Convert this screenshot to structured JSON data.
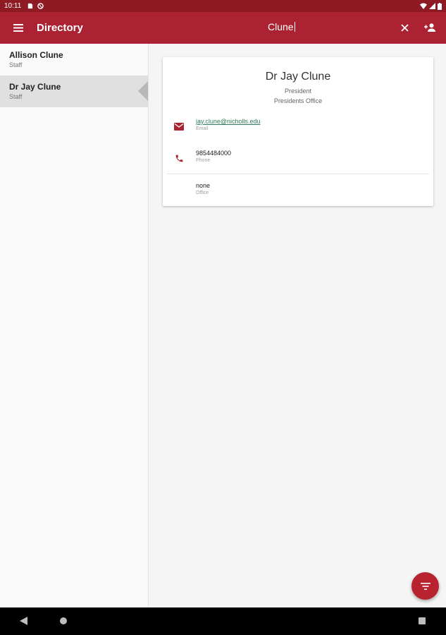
{
  "status_bar": {
    "time": "10:11"
  },
  "app_bar": {
    "title": "Directory",
    "search_value": "Clune"
  },
  "list": {
    "items": [
      {
        "name": "Allison Clune",
        "role": "Staff"
      },
      {
        "name": "Dr Jay Clune",
        "role": "Staff"
      }
    ]
  },
  "detail": {
    "name": "Dr Jay Clune",
    "title": "President",
    "department": "Presidents Office",
    "email": {
      "value": "jay.clune@nicholls.edu",
      "label": "Email"
    },
    "phone": {
      "value": "9854484000",
      "label": "Phone"
    },
    "office": {
      "value": "none",
      "label": "Office"
    }
  },
  "colors": {
    "status_bar": "#8e1b24",
    "app_bar": "#ab2332",
    "accent": "#b8232f",
    "link": "#2e7d5b"
  },
  "icons": [
    "menu-icon",
    "close-icon",
    "add-user-icon",
    "email-icon",
    "phone-icon",
    "filter-icon"
  ]
}
